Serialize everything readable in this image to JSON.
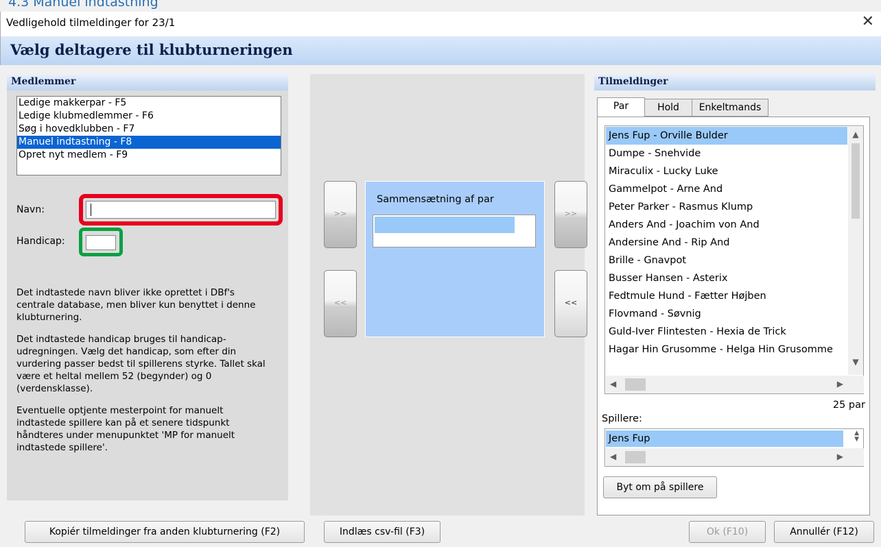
{
  "crumb_text": "4.3 Manuel indtastning",
  "window": {
    "title": "Vedligehold tilmeldinger for 23/1",
    "close_glyph": "✕"
  },
  "header": {
    "title": "Vælg deltagere til klubturneringen"
  },
  "members": {
    "section_title": "Medlemmer",
    "items": [
      "Ledige makkerpar - F5",
      "Ledige klubmedlemmer - F6",
      "Søg i hovedklubben - F7",
      "Manuel indtastning - F8",
      "Opret nyt medlem - F9"
    ],
    "selected_index": 3
  },
  "form": {
    "name_label": "Navn:",
    "name_value": "",
    "handicap_label": "Handicap:",
    "handicap_value": ""
  },
  "help": {
    "p1": "Det indtastede navn bliver ikke oprettet i DBf's centrale database, men bliver kun benyttet i denne klubturnering.",
    "p2": "Det indtastede handicap bruges til handicap-udregningen. Vælg det handicap, som efter din vurdering passer bedst til spillerens styrke. Tallet skal være et heltal mellem 52 (begynder) og 0 (verdensklasse).",
    "p3": "Eventuelle optjente mesterpoint for manuelt indtastede spillere kan på et senere tidspunkt håndteres under menupunktet 'MP for manuelt indtastede spillere'."
  },
  "middle": {
    "move_right_label": ">>",
    "move_left_label": "<<",
    "pair_title": "Sammensætning af par",
    "pair_add_label": ">>",
    "pair_remove_label": "<<"
  },
  "registrations": {
    "section_title": "Tilmeldinger",
    "tabs": [
      "Par",
      "Hold",
      "Enkeltmands"
    ],
    "active_tab": 0,
    "pairs": [
      "Jens Fup - Orville Bulder",
      "Dumpe - Snehvide",
      "Miraculix - Lucky Luke",
      "Gammelpot - Arne And",
      "Peter Parker - Rasmus Klump",
      "Anders And - Joachim von And",
      "Andersine And - Rip And",
      "Brille - Gnavpot",
      "Busser Hansen - Asterix",
      "Fedtmule Hund - Fætter Højben",
      "Flovmand - Søvnig",
      "Guld-Iver Flintesten - Hexia de Trick",
      "Hagar Hin Grusomme - Helga Hin Grusomme"
    ],
    "selected_index": 0,
    "count_text": "25 par",
    "players_label": "Spillere:",
    "players": [
      "Jens Fup"
    ],
    "swap_button": "Byt om på spillere"
  },
  "footer": {
    "copy_button": "Kopiér tilmeldinger fra anden klubturnering (F2)",
    "csv_button": "Indlæs csv-fil (F3)",
    "ok_button": "Ok (F10)",
    "cancel_button": "Annullér (F12)"
  },
  "colors": {
    "highlight_red": "#e6001e",
    "highlight_green": "#09a042",
    "selection_blue": "#0a64d2",
    "list_selection": "#99c9f8",
    "pair_panel": "#a9cdfb"
  }
}
